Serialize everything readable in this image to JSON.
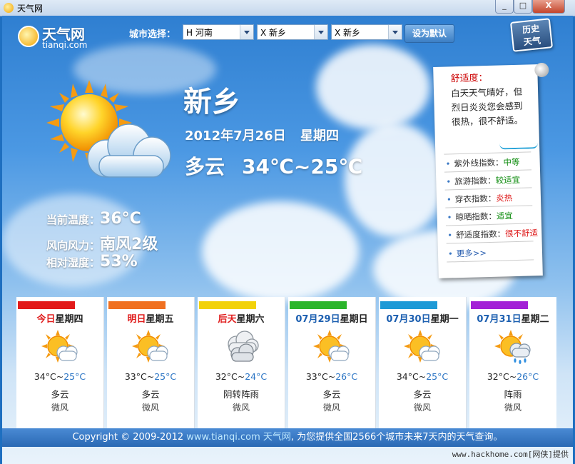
{
  "window": {
    "title": "天气网",
    "min_label": "_",
    "max_label": "□",
    "close_label": "X"
  },
  "logo": {
    "name": "天气网",
    "url": "tianqi.com"
  },
  "city_select": {
    "label": "城市选择：",
    "province": "H 河南",
    "city": "X 新乡",
    "district": "X 新乡",
    "set_default_label": "设为默认"
  },
  "history_button": {
    "line1": "历史",
    "line2": "天气"
  },
  "today": {
    "city": "新乡",
    "date": "2012年7月26日",
    "weekday": "星期四",
    "condition": "多云",
    "temp_range": "34℃~25℃"
  },
  "current": {
    "temp_label": "当前温度：",
    "temp_value": "36°C",
    "wind_label": "风向风力：",
    "wind_value": "南风2级",
    "humidity_label": "相对湿度：",
    "humidity_value": "53%"
  },
  "comfort": {
    "title": "舒适度：",
    "desc": "白天天气晴好，但烈日炎炎您会感到很热，很不舒适。",
    "indices": [
      {
        "label": "紫外线指数：",
        "value": "中等",
        "tone": "good"
      },
      {
        "label": "旅游指数：",
        "value": "较适宜",
        "tone": "good"
      },
      {
        "label": "穿衣指数：",
        "value": "炎热",
        "tone": "bad"
      },
      {
        "label": "晾晒指数：",
        "value": "适宜",
        "tone": "good"
      },
      {
        "label": "舒适度指数：",
        "value": "很不舒适",
        "tone": "bad"
      }
    ],
    "more": "更多>>"
  },
  "forecast": [
    {
      "day_a": "今日",
      "day_b": "星期四",
      "hi": "34°C",
      "lo": "25°C",
      "condition": "多云",
      "wind": "微风",
      "bar_color": "#e21a1a",
      "icon": "sun-cloud-icon"
    },
    {
      "day_a": "明日",
      "day_b": "星期五",
      "hi": "33°C",
      "lo": "25°C",
      "condition": "多云",
      "wind": "微风",
      "bar_color": "#f07020",
      "icon": "sun-cloud-icon"
    },
    {
      "day_a": "后天",
      "day_b": "星期六",
      "hi": "32°C",
      "lo": "24°C",
      "condition": "阴转阵雨",
      "wind": "微风",
      "bar_color": "#f2d20a",
      "icon": "cloud-icon"
    },
    {
      "day_a": "07月29日",
      "day_b": "星期日",
      "hi": "33°C",
      "lo": "26°C",
      "condition": "多云",
      "wind": "微风",
      "bar_color": "#2bb52b",
      "icon": "sun-cloud-icon"
    },
    {
      "day_a": "07月30日",
      "day_b": "星期一",
      "hi": "34°C",
      "lo": "25°C",
      "condition": "多云",
      "wind": "微风",
      "bar_color": "#1e9ad6",
      "icon": "sun-cloud-icon"
    },
    {
      "day_a": "07月31日",
      "day_b": "星期二",
      "hi": "32°C",
      "lo": "26°C",
      "condition": "阵雨",
      "wind": "微风",
      "bar_color": "#a321d6",
      "icon": "sun-rain-icon"
    }
  ],
  "footer": {
    "copyright": "Copyright © 2009-2012 ",
    "link": "www.tianqi.com 天气网",
    "tail": ", 为您提供全国2566个城市未来7天内的天气查询。"
  },
  "watermark": "www.hackhome.com[网侠]提供"
}
